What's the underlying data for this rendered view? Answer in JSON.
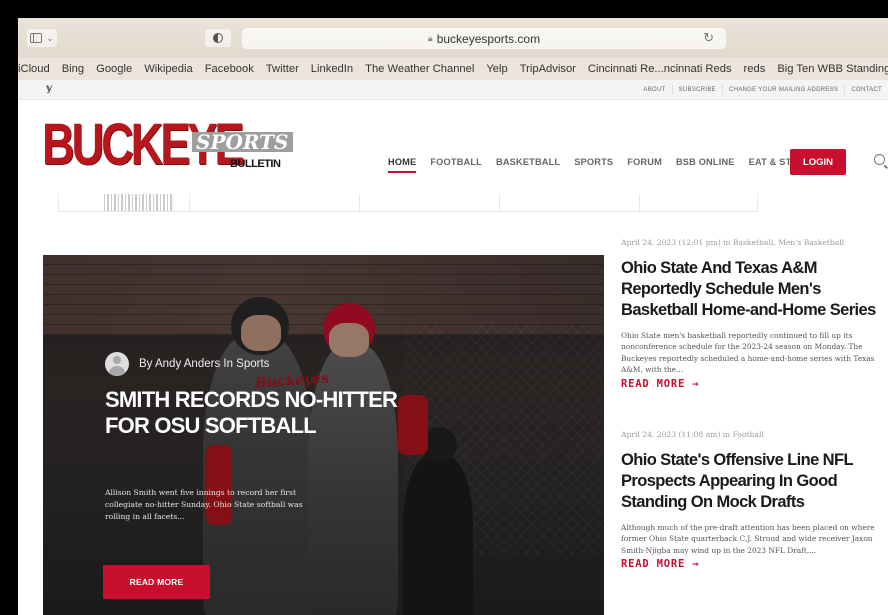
{
  "browser": {
    "url": "buckeyesports.com",
    "favorites": [
      "iCloud",
      "Bing",
      "Google",
      "Wikipedia",
      "Facebook",
      "Twitter",
      "LinkedIn",
      "The Weather Channel",
      "Yelp",
      "TripAdvisor",
      "Cincinnati Re...ncinnati Reds",
      "reds",
      "Big Ten WBB Standings"
    ]
  },
  "topbar": {
    "links": [
      "ABOUT",
      "SUBSCRIBE",
      "CHANGE YOUR MAILING ADDRESS",
      "CONTACT"
    ]
  },
  "logo": {
    "main": "BUCKEYE",
    "sports": "SPORTS",
    "bulletin": "BULLETIN"
  },
  "nav": {
    "items": [
      "HOME",
      "FOOTBALL",
      "BASKETBALL",
      "SPORTS",
      "FORUM",
      "BSB ONLINE",
      "EAT & STAY"
    ],
    "active": "HOME",
    "login": "LOGIN"
  },
  "hero": {
    "byline": "By Andy Anders In Sports",
    "jersey": "Buckeyes",
    "title": "SMITH RECORDS NO-HITTER FOR OSU SOFTBALL",
    "excerpt": "Allison Smith went five innings to record her first collegiate no-hitter Sunday. Ohio State softball was rolling in all facets...",
    "button": "READ MORE"
  },
  "posts": [
    {
      "meta": "April 24, 2023 (12:01 pm) in Basketball, Men's Basketball",
      "title": "Ohio State And Texas A&M Reportedly Schedule Men's Basketball Home-and-Home Series",
      "excerpt": "Ohio State men's basketball reportedly continued to fill up its nonconference schedule for the 2023-24 season on Monday. The Buckeyes reportedly scheduled a home-and-home series with Texas A&M, with the...",
      "read_more": "READ MORE →"
    },
    {
      "meta": "April 24, 2023 (11:08 am) in Football",
      "title": "Ohio State's Offensive Line NFL Prospects Appearing In Good Standing On Mock Drafts",
      "excerpt": "Although much of the pre-draft attention has been placed on where former Ohio State quarterback C.J. Stroud and wide receiver Jaxon Smith-Njigba may wind up in the 2023 NFL Draft,...",
      "read_more": "READ MORE →"
    }
  ],
  "colors": {
    "brand_red": "#c8102e",
    "chrome_bg": "#e6ded3"
  }
}
